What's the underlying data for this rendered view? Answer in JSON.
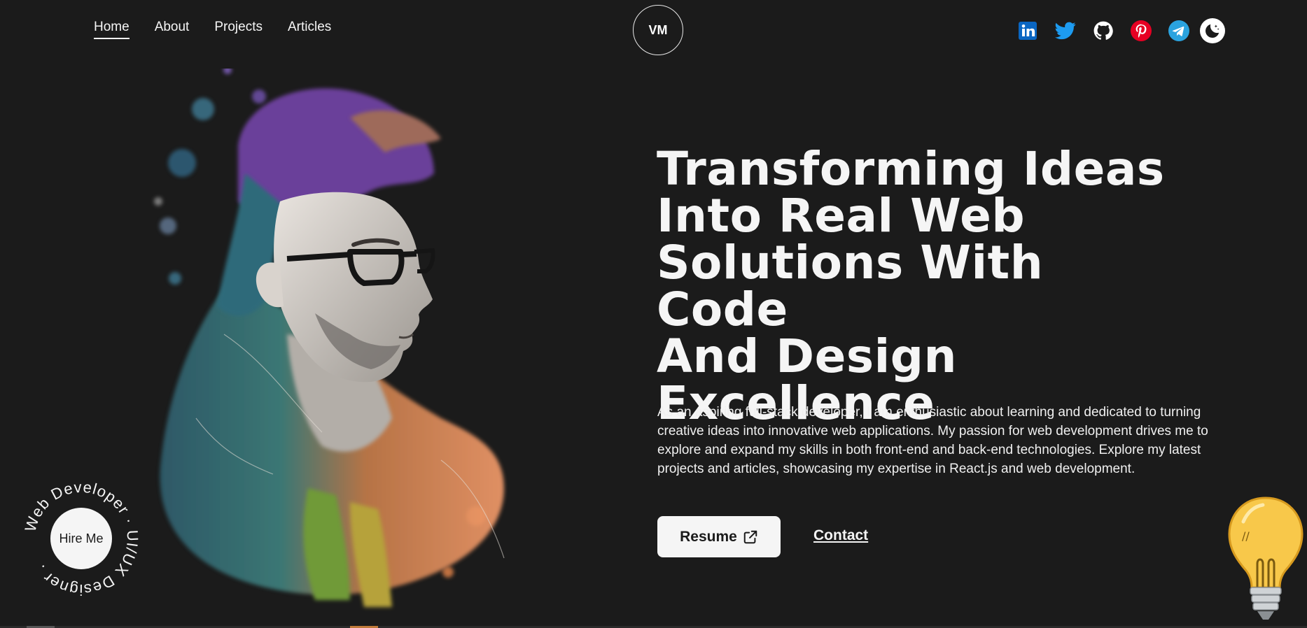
{
  "nav": {
    "items": [
      {
        "label": "Home",
        "active": true
      },
      {
        "label": "About",
        "active": false
      },
      {
        "label": "Projects",
        "active": false
      },
      {
        "label": "Articles",
        "active": false
      }
    ]
  },
  "logo": {
    "text": "VM"
  },
  "socials": [
    {
      "name": "linkedin-icon",
      "color": "#0a66c2"
    },
    {
      "name": "twitter-icon",
      "color": "#1d9bf0"
    },
    {
      "name": "github-icon",
      "color": "#ffffff"
    },
    {
      "name": "pinterest-icon",
      "color": "#e60023"
    },
    {
      "name": "telegram-icon",
      "color": "#2aa3df"
    },
    {
      "name": "moon-icon",
      "color": "#1b1b1b"
    }
  ],
  "hero": {
    "headline_lines": [
      "Transforming Ideas",
      "Into Real Web",
      "Solutions With Code",
      "And Design",
      "Excellence"
    ],
    "intro": "As an aspiring full-stack developer, I am enthusiastic about learning and dedicated to turning creative ideas into innovative web applications. My passion for web development drives me to explore and expand my skills in both front-end and back-end technologies. Explore my latest projects and articles, showcasing my expertise in React.js and web development.",
    "resume_label": "Resume",
    "contact_label": "Contact"
  },
  "hire": {
    "button_label": "Hire Me",
    "ring_text": "Web Developer · UI/UX Designer ."
  },
  "colors": {
    "background": "#1b1b1b",
    "text": "#f5f5f5",
    "bulb": "#f8c84a"
  }
}
